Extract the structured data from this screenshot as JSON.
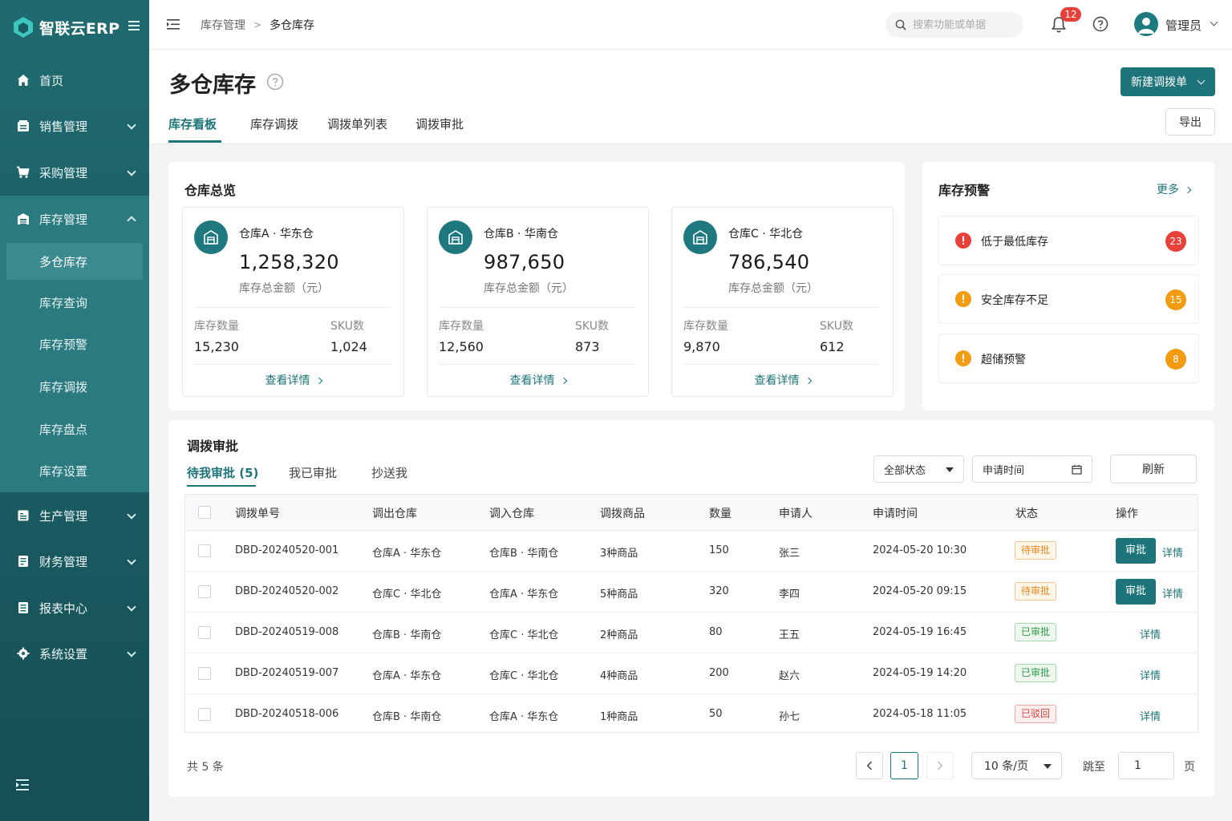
{
  "app": {
    "name": "智联云ERP"
  },
  "sidebar": {
    "items": [
      {
        "label": "首页",
        "icon": "home-icon"
      },
      {
        "label": "销售管理",
        "icon": "sales-icon"
      },
      {
        "label": "采购管理",
        "icon": "cart-icon"
      },
      {
        "label": "库存管理",
        "icon": "warehouse-icon"
      },
      {
        "label": "生产管理",
        "icon": "production-icon"
      },
      {
        "label": "财务管理",
        "icon": "finance-icon"
      },
      {
        "label": "报表中心",
        "icon": "report-icon"
      },
      {
        "label": "系统设置",
        "icon": "gear-icon"
      }
    ],
    "sub_items": [
      "多仓库存",
      "库存查询",
      "库存预警",
      "库存调拨",
      "库存盘点",
      "库存设置"
    ]
  },
  "topbar": {
    "breadcrumb": [
      "库存管理",
      "多仓库存"
    ],
    "search_placeholder": "搜索功能或单据",
    "notifications": "12",
    "user": "管理员"
  },
  "page": {
    "title": "多仓库存",
    "new_button": "新建调拨单",
    "export_button": "导出",
    "tabs": [
      "库存看板",
      "库存调拨",
      "调拨单列表",
      "调拨审批"
    ]
  },
  "overview": {
    "title": "仓库总览",
    "amount_label": "库存总金额（元）",
    "qty_label": "库存数量",
    "sku_label": "SKU数",
    "detail_link": "查看详情",
    "warehouses": [
      {
        "name": "仓库A · 华东仓",
        "amount": "1,258,320",
        "qty": "15,230",
        "sku": "1,024"
      },
      {
        "name": "仓库B · 华南仓",
        "amount": "987,650",
        "qty": "12,560",
        "sku": "873"
      },
      {
        "name": "仓库C · 华北仓",
        "amount": "786,540",
        "qty": "9,870",
        "sku": "612"
      }
    ]
  },
  "alerts": {
    "title": "库存预警",
    "more": "更多",
    "items": [
      {
        "label": "低于最低库存",
        "count": "23",
        "color": "#e8413a"
      },
      {
        "label": "安全库存不足",
        "count": "15",
        "color": "#f39c12"
      },
      {
        "label": "超储预警",
        "count": "8",
        "color": "#f39c12"
      }
    ]
  },
  "approval": {
    "title": "调拨审批",
    "tabs": [
      "待我审批 (5)",
      "我已审批",
      "抄送我"
    ],
    "status_filter": "全部状态",
    "date_filter": "申请时间",
    "refresh": "刷新",
    "columns": [
      "调拨单号",
      "调出仓库",
      "调入仓库",
      "调拨商品",
      "数量",
      "申请人",
      "申请时间",
      "状态",
      "操作"
    ],
    "approve_label": "审批",
    "detail_label": "详情",
    "rows": [
      {
        "no": "DBD-20240520-001",
        "from": "仓库A · 华东仓",
        "to": "仓库B · 华南仓",
        "goods": "3种商品",
        "qty": "150",
        "applicant": "张三",
        "time": "2024-05-20 10:30",
        "status": "待审批",
        "status_type": "pend"
      },
      {
        "no": "DBD-20240520-002",
        "from": "仓库C · 华北仓",
        "to": "仓库A · 华东仓",
        "goods": "5种商品",
        "qty": "320",
        "applicant": "李四",
        "time": "2024-05-20 09:15",
        "status": "待审批",
        "status_type": "pend"
      },
      {
        "no": "DBD-20240519-008",
        "from": "仓库B · 华南仓",
        "to": "仓库C · 华北仓",
        "goods": "2种商品",
        "qty": "80",
        "applicant": "王五",
        "time": "2024-05-19 16:45",
        "status": "已审批",
        "status_type": "ok"
      },
      {
        "no": "DBD-20240519-007",
        "from": "仓库A · 华东仓",
        "to": "仓库C · 华北仓",
        "goods": "4种商品",
        "qty": "200",
        "applicant": "赵六",
        "time": "2024-05-19 14:20",
        "status": "已审批",
        "status_type": "ok"
      },
      {
        "no": "DBD-20240518-006",
        "from": "仓库B · 华南仓",
        "to": "仓库A · 华东仓",
        "goods": "1种商品",
        "qty": "50",
        "applicant": "孙七",
        "time": "2024-05-18 11:05",
        "status": "已驳回",
        "status_type": "rej"
      }
    ]
  },
  "pagination": {
    "total": "共 5 条",
    "current": "1",
    "page_size": "10 条/页",
    "jump_label": "跳至",
    "jump_value": "1",
    "page_suffix": "页"
  }
}
